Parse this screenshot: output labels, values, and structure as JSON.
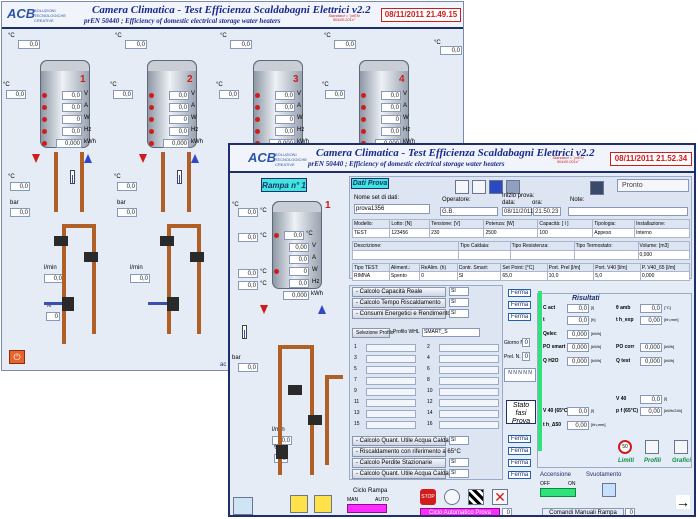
{
  "colors": {
    "accent": "#1f2f6a",
    "title": "#1a2a8c",
    "date": "#d01c1c",
    "ok": "#2fe27a",
    "pipe": "#b06026"
  },
  "logo": {
    "brand": "ACB",
    "tagline": "SOLUZIONI TECNOLOGICHE CREATIVE"
  },
  "window1": {
    "title": "Camera Climatica - Test Efficienza Scaldabagni Elettrici v2.2",
    "subtitle": "prEN 50440 ;  Efficiency of domestic electrical storage water heaters",
    "standard": "Standard = \"prEN 50440:201x\"",
    "datetime": "08/11/2011 21.49.15",
    "units": {
      "c": "°C",
      "v": "V",
      "a": "A",
      "w": "W",
      "hz": "Hz",
      "kwh": "kWh",
      "bar": "bar",
      "lmin": "l/min",
      "pct": "%"
    },
    "ambient": [
      "0,0",
      "0,0",
      "0,0",
      "0,0",
      "0,0"
    ],
    "heaters": [
      {
        "num": "1",
        "temp": "0,0",
        "v": "0,0",
        "a": "0,0",
        "w": "0",
        "hz": "0,0",
        "kwh": "0,000"
      },
      {
        "num": "2",
        "temp": "0,0",
        "v": "0,0",
        "a": "0,0",
        "w": "0",
        "hz": "0,0",
        "kwh": "0,000"
      },
      {
        "num": "3",
        "temp": "0,0",
        "v": "0,0",
        "a": "0,0",
        "w": "0",
        "hz": "0,0",
        "kwh": "0,000"
      },
      {
        "num": "4",
        "temp": "0,0",
        "v": "0,0",
        "a": "0,0",
        "w": "0",
        "hz": "0,0",
        "kwh": "0,000"
      }
    ],
    "temps_low": [
      "0,0",
      "0,0"
    ],
    "bar_values": [
      "0,0",
      "0,0"
    ],
    "flow_values": [
      "0,0",
      "0,0"
    ],
    "pct_value": "0",
    "footer": "ac"
  },
  "window2": {
    "title": "Camera Climatica - Test Efficienza Scaldabagni Elettrici v2.2",
    "subtitle": "prEN 50440 ;  Efficiency of domestic electrical storage water heaters",
    "standard": "Standard = \"prEN 50440:201x\"",
    "datetime": "08/11/2011 21.52.34",
    "rampa": "Rampa n° 1",
    "pronto": "Pronto",
    "dati_prova": "Dati Prova",
    "risultati": "Risultati",
    "heater": {
      "temp": "0,0",
      "v": "0,00",
      "a": "0,0",
      "w": "0",
      "hz": "0,0",
      "kwh": "0,000"
    },
    "ambient": [
      "0,0",
      "0,0",
      "0,0",
      "0,0"
    ],
    "bar_value": "0,0",
    "flow_value": "0,0",
    "pct_value": "0",
    "form": {
      "nome_label": "Nome set di dati:",
      "nome_value": "prova1356",
      "operatore_label": "Operatore:",
      "operatore_value": "G.B.",
      "inizio_label": "Inizio prova:",
      "data_label": "data:",
      "ora_label": "ora:",
      "data_value": "08/11/2011",
      "ora_value": "21.50.23",
      "note_label": "Note:",
      "modello_label": "Modello:",
      "modello_value": "TEST",
      "lotto_label": "Lotto: [N]",
      "lotto_value": "123456",
      "tensione_label": "Tensione: [V]",
      "tensione_value": "230",
      "potenza_label": "Potenza: [W]",
      "potenza_value": "2500",
      "capacita_label": "Capacità: [ l ]",
      "capacita_value": "100",
      "tipologia_label": "Tipologia:",
      "tipologia_value": "Appeso",
      "installazione_label": "Installazione:",
      "installazione_value": "Interno",
      "descrizione_label": "Descrizione:",
      "tipo_caldaia_label": "Tipo Caldaia:",
      "tipo_resistenza_label": "Tipo Resistenza:",
      "tipo_termostato_label": "Tipo Termostato:",
      "volume_label": "Volume: [m3]",
      "volume_value": "0,000",
      "tipo_test_label": "Tipo TEST:",
      "tipo_test_value": "RIMNA",
      "alim_label": "Aliment.:",
      "alim_value": "Spento",
      "realim_label": "ReAlim. (h)",
      "realim_value": "0",
      "contr_label": "Contr. Smart:",
      "contr_value": "SI",
      "setpoint_label": "Set Point: [°C]",
      "setpoint_value": "65,0",
      "pprel_label": "Port. Prel [l/m]",
      "pprel_value": "10,0",
      "pv40_label": "Port. V40 [l/m]",
      "pv40_value": "5,0",
      "p_v40_label": "P. V40_65 [l/m]",
      "p_v40_value": "0,000"
    },
    "calc_top": [
      {
        "label": "- Calcolo Capacità Reale",
        "sel": "SI"
      },
      {
        "label": "- Calcolo Tempo Riscaldamento",
        "sel": "SI"
      },
      {
        "label": "- Consumi Energetici e Rendimento",
        "sel": "SI"
      }
    ],
    "profilo": {
      "btn": "Selezione Profilo:",
      "label": "Profilo WHL",
      "value": "SMART_S"
    },
    "profile_rows": [
      "1",
      "2",
      "3",
      "4",
      "5",
      "6",
      "7",
      "8",
      "9",
      "10",
      "11",
      "12",
      "13",
      "14",
      "15",
      "16"
    ],
    "calc_bottom": [
      {
        "label": "- Calcolo Quant. Utile Acqua Calda",
        "sel": "SI"
      },
      {
        "label": "- Riscaldamento con riferimento a 65°C",
        "sel": ""
      },
      {
        "label": "- Calcolo Perdite Stazionarie",
        "sel": "SI"
      },
      {
        "label": "- Calcolo Quant. Utile Acqua Calda a 65°",
        "sel": "SI"
      }
    ],
    "ferma_label": "Ferma",
    "giorno_label": "Giorno N.",
    "giorno_value": "0",
    "prel_label": "Prel. N.",
    "prel_value": "0",
    "stato": "Stato fasi Prova",
    "nnnn": "N N N N N",
    "results": {
      "cact_label": "C act",
      "cact_value": "0,0",
      "cact_unit": "[l]",
      "theta_label": "θ amb",
      "theta_value": "0,0",
      "theta_unit": "[°C]",
      "t_label": "t",
      "t_value": "0,0",
      "t_unit": "[h]",
      "theap_label": "t h_exp",
      "theap_value": "0,00",
      "theap_unit": "[hh,mm]",
      "qelec_label": "Qelec",
      "qelec_value": "0,000",
      "qelec_unit": "[kWh]",
      "po_label": "PO smart",
      "po_value": "0,000",
      "po_unit": "[kWh]",
      "po2_label": "PO corr",
      "po2_value": "0,000",
      "po2_unit": "[kWh]",
      "qh2o_label": "Q H2O",
      "qh2o_value": "0,000",
      "qh2o_unit": "[kWh]",
      "qtest_label": "Q test",
      "qtest_value": "0,000",
      "qtest_unit": "[kWh]",
      "v40_label": "V 40",
      "v40_value": "0,0",
      "v40_unit": "[l]",
      "v40b_label": "V 40 (65°C)",
      "v40b_value": "0,0",
      "v40b_unit": "[l]",
      "pf_label": "p f (65°C)",
      "pf_value": "0,00",
      "pf_unit": "[kWh/24h]",
      "td_label": "t h_Δ50",
      "td_value": "0,00",
      "td_unit": "[hh,mm]"
    },
    "tools": {
      "limiti": "Limiti",
      "profili": "Profili",
      "grafici": "Grafici"
    },
    "accensione": "Accensione",
    "off": "OFF",
    "on": "ON",
    "svuotamento": "Svuotamento",
    "ciclo_rampa": "Ciclo Rampa",
    "man": "MAN",
    "auto": "AUTO",
    "ciclo_auto": "Ciclo Automatico Prova",
    "ciclo_auto_value": "0",
    "comandi": "Comandi Manuali Rampa",
    "comandi_value": "0",
    "arrow": "→"
  }
}
